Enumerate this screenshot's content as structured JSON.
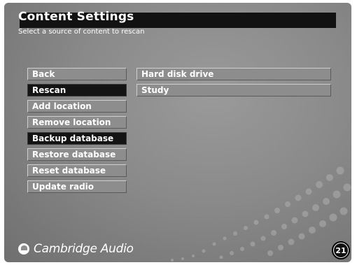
{
  "header": {
    "title": "Content Settings",
    "subtitle": "Select a source of content to rescan"
  },
  "menu": {
    "items": [
      {
        "label": "Back",
        "selected": false
      },
      {
        "label": "Rescan",
        "selected": true
      },
      {
        "label": "Add location",
        "selected": false
      },
      {
        "label": "Remove location",
        "selected": false
      },
      {
        "label": "Backup database",
        "selected": true
      },
      {
        "label": "Restore database",
        "selected": false
      },
      {
        "label": "Reset database",
        "selected": false
      },
      {
        "label": "Update radio",
        "selected": false
      }
    ]
  },
  "sources": {
    "items": [
      {
        "label": "Hard disk drive"
      },
      {
        "label": "Study"
      }
    ]
  },
  "brand": {
    "name": "Cambridge Audio",
    "icon": "cambridge-audio-logo-icon"
  },
  "page": {
    "number": "21"
  },
  "colors": {
    "background": "#8a8a8a",
    "title_bar": "#121212",
    "item_normal": "#8d8d8d",
    "item_selected": "#141414",
    "text": "#ffffff"
  }
}
